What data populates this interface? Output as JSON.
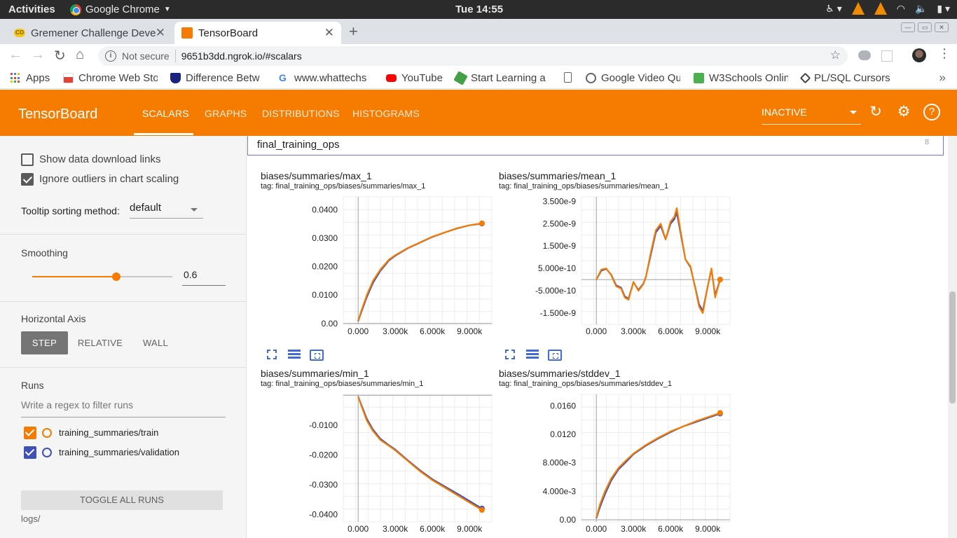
{
  "system_bar": {
    "activities": "Activities",
    "app_name": "Google Chrome",
    "clock": "Tue 14:55"
  },
  "browser": {
    "tabs": [
      {
        "title": "Gremener Challenge Deve",
        "active": false
      },
      {
        "title": "TensorBoard",
        "active": true
      }
    ],
    "address": {
      "security": "Not secure",
      "url": "9651b3dd.ngrok.io/#scalars"
    },
    "bookmarks": [
      {
        "label": "Apps"
      },
      {
        "label": "Chrome Web Sto"
      },
      {
        "label": "Difference Betw"
      },
      {
        "label": "www.whattechs"
      },
      {
        "label": "YouTube"
      },
      {
        "label": "Start Learning a"
      },
      {
        "label": ""
      },
      {
        "label": "Google Video Qu"
      },
      {
        "label": "W3Schools Onlin"
      },
      {
        "label": "PL/SQL Cursors"
      }
    ]
  },
  "tensorboard": {
    "title": "TensorBoard",
    "nav": [
      "SCALARS",
      "GRAPHS",
      "DISTRIBUTIONS",
      "HISTOGRAMS"
    ],
    "active_nav": "SCALARS",
    "plugin_select": "INACTIVE",
    "accent_color": "#f57c00"
  },
  "sidebar": {
    "show_download_links": {
      "label": "Show data download links",
      "checked": false
    },
    "ignore_outliers": {
      "label": "Ignore outliers in chart scaling",
      "checked": true
    },
    "tooltip_sorting": {
      "label": "Tooltip sorting method:",
      "value": "default"
    },
    "smoothing": {
      "label": "Smoothing",
      "value": "0.6",
      "fraction": 0.6
    },
    "horizontal_axis": {
      "label": "Horizontal Axis",
      "options": [
        "STEP",
        "RELATIVE",
        "WALL"
      ],
      "selected": "STEP"
    },
    "runs": {
      "label": "Runs",
      "filter_placeholder": "Write a regex to filter runs",
      "items": [
        {
          "name": "training_summaries/train",
          "color": "#f57c00",
          "checked": true
        },
        {
          "name": "training_summaries/validation",
          "color": "#3f51b5",
          "checked": true
        }
      ],
      "toggle_all": "TOGGLE ALL RUNS",
      "logdir": "logs/"
    }
  },
  "main": {
    "group": {
      "name": "final_training_ops",
      "count": "8"
    }
  },
  "chart_data": [
    {
      "type": "line",
      "title": "biases/summaries/max_1",
      "tag": "tag: final_training_ops/biases/summaries/max_1",
      "xlim": [
        -1200,
        10800
      ],
      "ylim": [
        -0.0003,
        0.0445
      ],
      "x_ticks": [
        0,
        3000,
        6000,
        9000
      ],
      "x_tick_labels": [
        "0.000",
        "3.000k",
        "6.000k",
        "9.000k"
      ],
      "y_ticks": [
        0,
        0.01,
        0.02,
        0.03,
        0.04
      ],
      "y_tick_labels": [
        "0.00",
        "0.0100",
        "0.0200",
        "0.0300",
        "0.0400"
      ],
      "series": [
        {
          "name": "training_summaries/train",
          "color": "#f57c00",
          "x": [
            0,
            300,
            700,
            1200,
            1800,
            2500,
            3000,
            4000,
            5000,
            6000,
            7000,
            8000,
            9000,
            10000
          ],
          "y": [
            0.001,
            0.005,
            0.01,
            0.015,
            0.019,
            0.0225,
            0.024,
            0.0265,
            0.0285,
            0.0305,
            0.032,
            0.0335,
            0.0345,
            0.0352
          ]
        },
        {
          "name": "training_summaries/validation",
          "color": "#3f51b5",
          "x": [
            0,
            300,
            700,
            1200,
            1800,
            2500,
            3000,
            4000,
            5000,
            6000,
            7000,
            8000,
            9000,
            10000
          ],
          "y": [
            0.0008,
            0.0045,
            0.0093,
            0.0143,
            0.0185,
            0.0222,
            0.0238,
            0.0264,
            0.0284,
            0.0304,
            0.032,
            0.0334,
            0.0345,
            0.0351
          ]
        }
      ]
    },
    {
      "type": "line",
      "title": "biases/summaries/mean_1",
      "tag": "tag: final_training_ops/biases/summaries/mean_1",
      "xlim": [
        -1200,
        10800
      ],
      "ylim": [
        -2e-09,
        3.7e-09
      ],
      "x_ticks": [
        0,
        3000,
        6000,
        9000
      ],
      "x_tick_labels": [
        "0.000",
        "3.000k",
        "6.000k",
        "9.000k"
      ],
      "y_ticks": [
        -1.5e-09,
        -5e-10,
        5e-10,
        1.5e-09,
        2.5e-09,
        3.5e-09
      ],
      "y_tick_labels": [
        "-1.500e-9",
        "-5.000e-10",
        "5.000e-10",
        "1.500e-9",
        "2.500e-9",
        "3.500e-9"
      ],
      "series": [
        {
          "name": "training_summaries/train",
          "color": "#f57c00",
          "x": [
            0,
            400,
            800,
            1200,
            1600,
            2000,
            2300,
            2600,
            3000,
            3400,
            3800,
            4000,
            4400,
            4800,
            5200,
            5600,
            6000,
            6300,
            6500,
            6800,
            7200,
            7600,
            8000,
            8300,
            8600,
            9000,
            9300,
            9600,
            10000
          ],
          "y": [
            0,
            4.5e-10,
            5e-10,
            2e-10,
            -3e-10,
            -4e-10,
            -8e-10,
            -9e-10,
            -1e-10,
            -5e-10,
            -2e-10,
            1e-10,
            1.2e-09,
            2.2e-09,
            2.5e-09,
            1.8e-09,
            2.6e-09,
            2.8e-09,
            3.2e-09,
            2.2e-09,
            9e-10,
            6e-10,
            -4e-10,
            -1.2e-09,
            -1.5e-09,
            -3e-10,
            5e-10,
            -8e-10,
            0
          ]
        },
        {
          "name": "training_summaries/validation",
          "color": "#3f51b5",
          "x": [
            0,
            400,
            800,
            1200,
            1600,
            2000,
            2300,
            2600,
            3000,
            3400,
            3800,
            4000,
            4400,
            4800,
            5200,
            5600,
            6000,
            6300,
            6500,
            6800,
            7200,
            7600,
            8000,
            8300,
            8600,
            9000,
            9300,
            9600,
            10000
          ],
          "y": [
            0,
            4e-10,
            4.8e-10,
            2.2e-10,
            -2.6e-10,
            -3.6e-10,
            -7.5e-10,
            -8.5e-10,
            -1.2e-10,
            -4.6e-10,
            -1.8e-10,
            1.2e-10,
            1.1e-09,
            2.1e-09,
            2.4e-09,
            1.8e-09,
            2.5e-09,
            2.7e-09,
            3e-09,
            2.1e-09,
            9e-10,
            5.6e-10,
            -3.6e-10,
            -1.1e-09,
            -1.4e-09,
            -3e-10,
            4.5e-10,
            -7e-10,
            0
          ]
        }
      ]
    },
    {
      "type": "line",
      "title": "biases/summaries/min_1",
      "tag": "tag: final_training_ops/biases/summaries/min_1",
      "xlim": [
        -1200,
        10800
      ],
      "ylim": [
        -0.0425,
        0.0003
      ],
      "x_ticks": [
        0,
        3000,
        6000,
        9000
      ],
      "x_tick_labels": [
        "0.000",
        "3.000k",
        "6.000k",
        "9.000k"
      ],
      "y_ticks": [
        -0.01,
        -0.02,
        -0.03,
        -0.04
      ],
      "y_tick_labels": [
        "-0.0100",
        "-0.0200",
        "-0.0300",
        "-0.0400"
      ],
      "series": [
        {
          "name": "training_summaries/train",
          "color": "#f57c00",
          "x": [
            0,
            300,
            700,
            1200,
            1800,
            2500,
            3000,
            4000,
            5000,
            6000,
            7000,
            8000,
            9000,
            10000
          ],
          "y": [
            -0.0005,
            -0.004,
            -0.0085,
            -0.012,
            -0.015,
            -0.017,
            -0.0185,
            -0.022,
            -0.0255,
            -0.0285,
            -0.031,
            -0.0335,
            -0.036,
            -0.0385
          ]
        },
        {
          "name": "training_summaries/validation",
          "color": "#3f51b5",
          "x": [
            0,
            300,
            700,
            1200,
            1800,
            2500,
            3000,
            4000,
            5000,
            6000,
            7000,
            8000,
            9000,
            10000
          ],
          "y": [
            -0.0004,
            -0.0036,
            -0.0079,
            -0.0115,
            -0.0146,
            -0.0168,
            -0.0182,
            -0.0218,
            -0.0252,
            -0.0282,
            -0.0306,
            -0.033,
            -0.0355,
            -0.038
          ]
        }
      ]
    },
    {
      "type": "line",
      "title": "biases/summaries/stddev_1",
      "tag": "tag: final_training_ops/biases/summaries/stddev_1",
      "xlim": [
        -1200,
        10800
      ],
      "ylim": [
        -0.0003,
        0.0176
      ],
      "x_ticks": [
        0,
        3000,
        6000,
        9000
      ],
      "x_tick_labels": [
        "0.000",
        "3.000k",
        "6.000k",
        "9.000k"
      ],
      "y_ticks": [
        0,
        0.004,
        0.008,
        0.012,
        0.016
      ],
      "y_tick_labels": [
        "0.00",
        "4.000e-3",
        "8.000e-3",
        "0.0120",
        "0.0160"
      ],
      "series": [
        {
          "name": "training_summaries/train",
          "color": "#f57c00",
          "x": [
            0,
            300,
            700,
            1200,
            1800,
            2500,
            3000,
            4000,
            5000,
            6000,
            7000,
            8000,
            9000,
            10000
          ],
          "y": [
            0.0003,
            0.0022,
            0.004,
            0.0058,
            0.0073,
            0.0085,
            0.0093,
            0.0105,
            0.0115,
            0.0124,
            0.0131,
            0.0138,
            0.0144,
            0.015
          ]
        },
        {
          "name": "training_summaries/validation",
          "color": "#3f51b5",
          "x": [
            0,
            300,
            700,
            1200,
            1800,
            2500,
            3000,
            4000,
            5000,
            6000,
            7000,
            8000,
            9000,
            10000
          ],
          "y": [
            0.0002,
            0.0018,
            0.0036,
            0.0055,
            0.0071,
            0.0083,
            0.0092,
            0.0104,
            0.0114,
            0.0123,
            0.0131,
            0.0137,
            0.0143,
            0.0149
          ]
        }
      ]
    }
  ]
}
